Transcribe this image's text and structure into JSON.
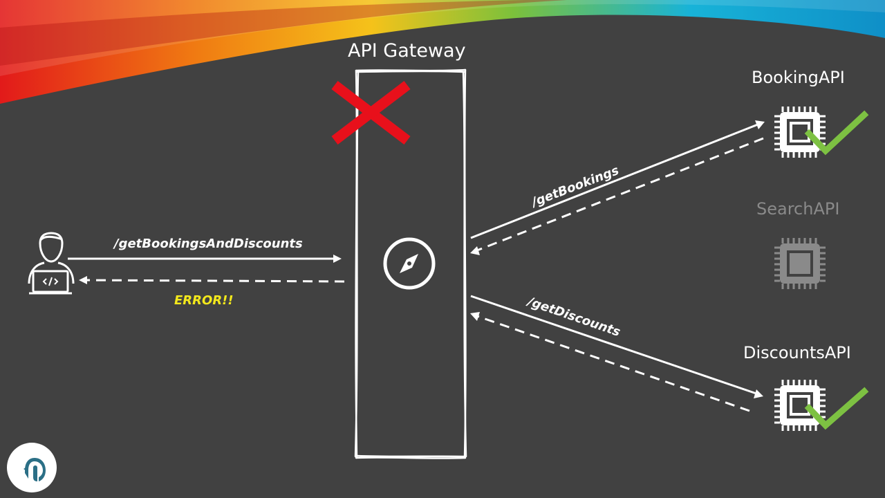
{
  "gateway": {
    "title": "API Gateway"
  },
  "services": {
    "booking": {
      "name": "BookingAPI",
      "status": "ok"
    },
    "search": {
      "name": "SearchAPI",
      "status": "inactive"
    },
    "discounts": {
      "name": "DiscountsAPI",
      "status": "ok"
    }
  },
  "routes": {
    "client_request": "/getBookingsAndDiscounts",
    "client_response": "ERROR!!",
    "booking_request": "/getBookings",
    "discounts_request": "/getDiscounts"
  },
  "colors": {
    "background": "#414141",
    "line": "#ffffff",
    "error": "#f3e81c",
    "fail_mark": "#e8101b",
    "ok_mark": "#7dc142",
    "inactive": "#8a8a8a",
    "logo_accent": "#2b6f86"
  },
  "icons": {
    "client": "developer-laptop-icon",
    "gateway": "compass-icon",
    "service": "chip-icon",
    "fail": "red-x-icon",
    "ok": "check-icon",
    "logo": "bird-logo-icon"
  }
}
